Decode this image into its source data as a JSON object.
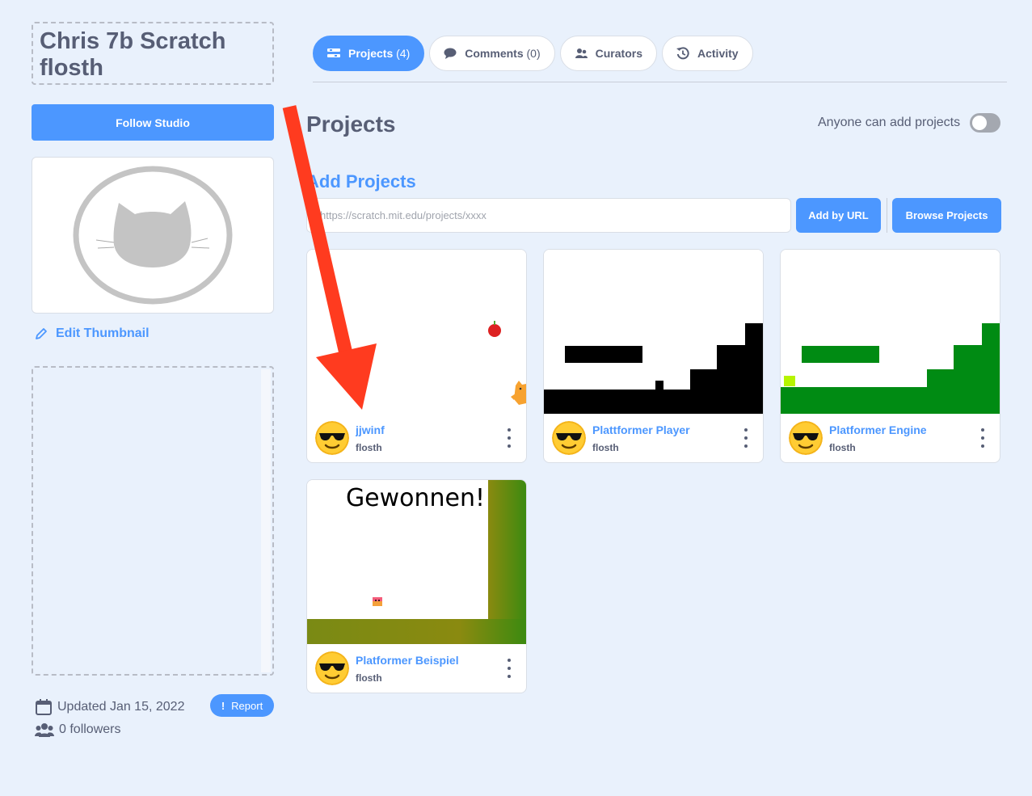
{
  "studio": {
    "title": "Chris 7b Scratch flosth",
    "follow_label": "Follow Studio",
    "edit_thumbnail_label": "Edit Thumbnail",
    "updated_text": "Updated Jan 15, 2022",
    "followers_text": "0 followers",
    "report_label": "Report"
  },
  "tabs": [
    {
      "label": "Projects",
      "count": "(4)",
      "icon": "projects-icon",
      "active": true
    },
    {
      "label": "Comments",
      "count": "(0)",
      "icon": "comment-bubble-icon",
      "active": false
    },
    {
      "label": "Curators",
      "count": "",
      "icon": "people-icon",
      "active": false
    },
    {
      "label": "Activity",
      "count": "",
      "icon": "history-icon",
      "active": false
    }
  ],
  "projects_section": {
    "title": "Projects",
    "anyone_label": "Anyone can add projects",
    "anyone_enabled": false,
    "add_title": "Add Projects",
    "url_placeholder": "https://scratch.mit.edu/projects/xxxx",
    "add_by_url_label": "Add by URL",
    "browse_label": "Browse Projects"
  },
  "projects": [
    {
      "title": "jjwinf",
      "author": "flosth",
      "thumbnail": "apple-and-cat"
    },
    {
      "title": "Plattformer Player",
      "author": "flosth",
      "thumbnail": "black-platforms"
    },
    {
      "title": "Platformer Engine",
      "author": "flosth",
      "thumbnail": "green-platforms"
    },
    {
      "title": "Platformer Beispiel",
      "author": "flosth",
      "thumbnail": "gewonnen",
      "thumbnail_text": "Gewonnen!"
    }
  ],
  "colors": {
    "accent": "#4c97ff",
    "background": "#e9f1fc",
    "text": "#575e75",
    "annotation_arrow": "#ff3b1f"
  }
}
